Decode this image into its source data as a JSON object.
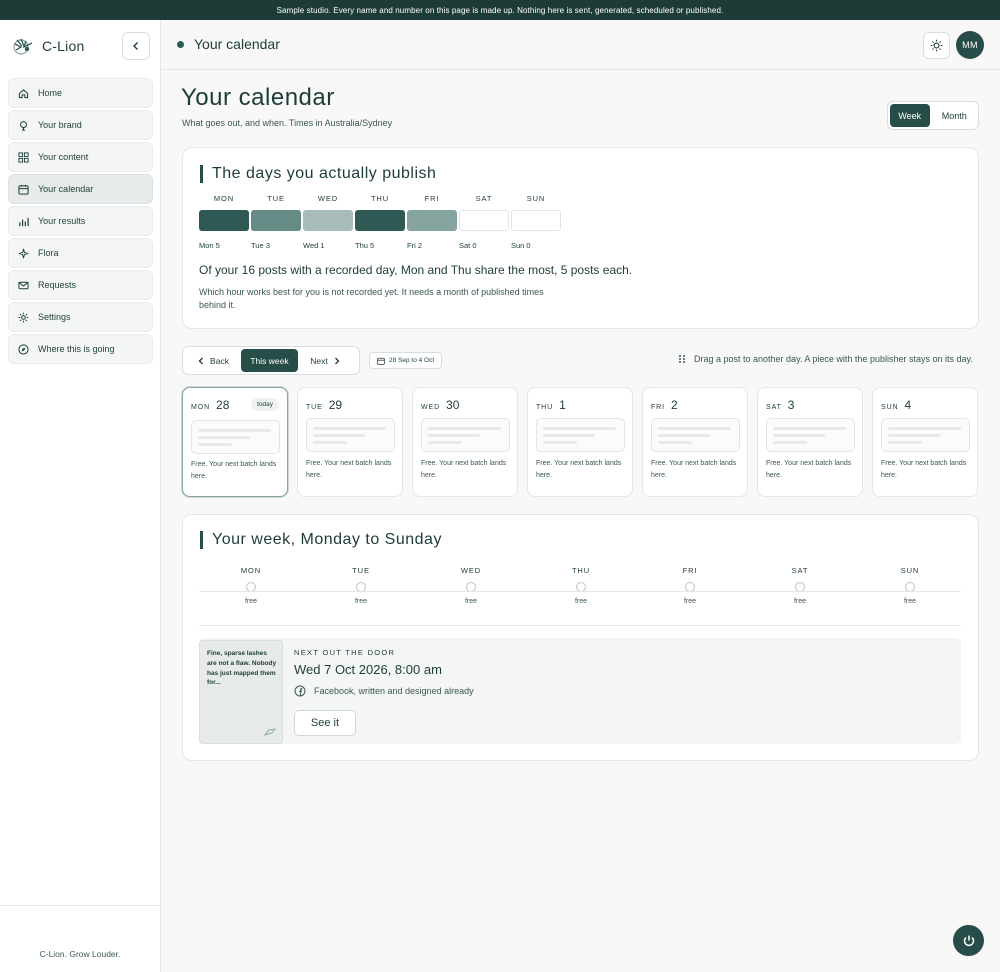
{
  "banner": "Sample studio. Every name and number on this page is made up. Nothing here is sent, generated, scheduled or published.",
  "brand": {
    "name": "C-Lion"
  },
  "sidebar": {
    "items": [
      {
        "label": "Home",
        "icon": "home-icon"
      },
      {
        "label": "Your brand",
        "icon": "brand-icon"
      },
      {
        "label": "Your content",
        "icon": "grid-icon"
      },
      {
        "label": "Your calendar",
        "icon": "calendar-icon",
        "active": true
      },
      {
        "label": "Your results",
        "icon": "chart-icon"
      },
      {
        "label": "Flora",
        "icon": "sparkle-icon"
      },
      {
        "label": "Requests",
        "icon": "mail-icon"
      },
      {
        "label": "Settings",
        "icon": "gear-icon"
      },
      {
        "label": "Where this is going",
        "icon": "compass-icon"
      }
    ],
    "footer": "C-Lion. Grow Louder."
  },
  "header": {
    "title": "Your calendar",
    "avatar": "MM"
  },
  "page": {
    "title": "Your calendar",
    "subtitle": "What goes out, and when. Times in Australia/Sydney",
    "view": {
      "week": "Week",
      "month": "Month",
      "selected": "Week"
    }
  },
  "publish_days": {
    "title": "The days you actually publish",
    "days": [
      {
        "dow": "MON",
        "count": "Mon 5",
        "color": "#2f5954"
      },
      {
        "dow": "TUE",
        "count": "Tue 3",
        "color": "#668a85"
      },
      {
        "dow": "WED",
        "count": "Wed 1",
        "color": "#a8bdb9"
      },
      {
        "dow": "THU",
        "count": "Thu 5",
        "color": "#2f5954"
      },
      {
        "dow": "FRI",
        "count": "Fri 2",
        "color": "#86a49f"
      },
      {
        "dow": "SAT",
        "count": "Sat 0",
        "color": "#ffffff"
      },
      {
        "dow": "SUN",
        "count": "Sun 0",
        "color": "#ffffff"
      }
    ],
    "insight": "Of your 16 posts with a recorded day, Mon and Thu share the most, 5 posts each.",
    "insight_sub": "Which hour works best for you is not recorded yet. It needs a month of published times behind it."
  },
  "pager": {
    "back": "Back",
    "this_week": "This week",
    "next": "Next",
    "range": "28 Sep to 4 Oct"
  },
  "drag_hint": "Drag a post to another day. A piece with the publisher stays on its day.",
  "day_cards": [
    {
      "dow": "MON",
      "num": "28",
      "today": "today",
      "text": "Free. Your next batch lands here."
    },
    {
      "dow": "TUE",
      "num": "29",
      "text": "Free. Your next batch lands here."
    },
    {
      "dow": "WED",
      "num": "30",
      "text": "Free. Your next batch lands here."
    },
    {
      "dow": "THU",
      "num": "1",
      "text": "Free. Your next batch lands here."
    },
    {
      "dow": "FRI",
      "num": "2",
      "text": "Free. Your next batch lands here."
    },
    {
      "dow": "SAT",
      "num": "3",
      "text": "Free. Your next batch lands here."
    },
    {
      "dow": "SUN",
      "num": "4",
      "text": "Free. Your next batch lands here."
    }
  ],
  "week": {
    "title": "Your week, Monday to Sunday",
    "days": [
      {
        "dow": "MON",
        "status": "free"
      },
      {
        "dow": "TUE",
        "status": "free"
      },
      {
        "dow": "WED",
        "status": "free"
      },
      {
        "dow": "THU",
        "status": "free"
      },
      {
        "dow": "FRI",
        "status": "free"
      },
      {
        "dow": "SAT",
        "status": "free"
      },
      {
        "dow": "SUN",
        "status": "free"
      }
    ]
  },
  "next_post": {
    "label": "NEXT OUT THE DOOR",
    "date": "Wed 7 Oct 2026, 8:00 am",
    "meta": "Facebook, written and designed already",
    "thumb_text": "Fine, sparse lashes are not a flaw. Nobody has just mapped them for...",
    "button": "See it"
  }
}
